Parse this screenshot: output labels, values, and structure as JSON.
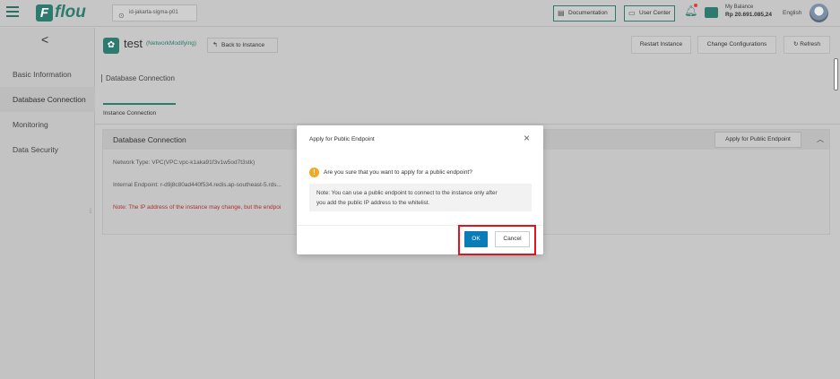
{
  "brand": {
    "logo_letter": "F",
    "name": "flou"
  },
  "topbar": {
    "region": "id-jakarta-sigma-p01",
    "documentation": "Documentation",
    "user_center": "User Center",
    "balance_label": "My Balance",
    "balance_value": "Rp 20.691.085,24",
    "language": "English"
  },
  "sidebar": {
    "collapse_glyph": "<",
    "items": [
      {
        "label": "Basic Information"
      },
      {
        "label": "Database Connection"
      },
      {
        "label": "Monitoring"
      },
      {
        "label": "Data Security"
      }
    ]
  },
  "instance": {
    "name": "test",
    "tag": "(NetworkModifying)",
    "back_label": "Back to Instance"
  },
  "actions": {
    "restart": "Restart Instance",
    "change_config": "Change Configurations",
    "refresh": "Refresh"
  },
  "page": {
    "section_title": "Database Connection",
    "tab": "Instance Connection"
  },
  "db_panel": {
    "title": "Database Connection",
    "apply_button": "Apply for Public Endpoint",
    "network_type": "Network Type:  VPC(VPC:vpc-k1aka91f3v1w5od7t3stk)",
    "internal_endpoint": "Internal Endpoint:  r-d9j8c80ad440f534.redis.ap-southeast-5.rds...",
    "note": "Note:  The IP address of the instance may change, but the endpoi"
  },
  "modal": {
    "title": "Apply for Public Endpoint",
    "close_glyph": "×",
    "question": "Are you sure that you want to apply for a public endpoint?",
    "note_line1": "Note: You can use a public endpoint to connect to the instance only after",
    "note_line2": "you add the public IP address to the whitelist.",
    "ok": "OK",
    "cancel": "Cancel"
  },
  "icons": {
    "pin": "location-pin-icon",
    "doc": "document-icon",
    "user": "user-icon",
    "bell": "bell-icon",
    "wallet": "wallet-icon",
    "back": "back-arrow-icon",
    "refresh": "refresh-icon",
    "chevron": "chevron-up-icon",
    "warning": "warning-icon"
  },
  "colors": {
    "brand": "#2d7a6e",
    "primary_button": "#0a7db7",
    "highlight": "#e0141e",
    "warning": "#f5a623",
    "note_text": "#b03030"
  }
}
